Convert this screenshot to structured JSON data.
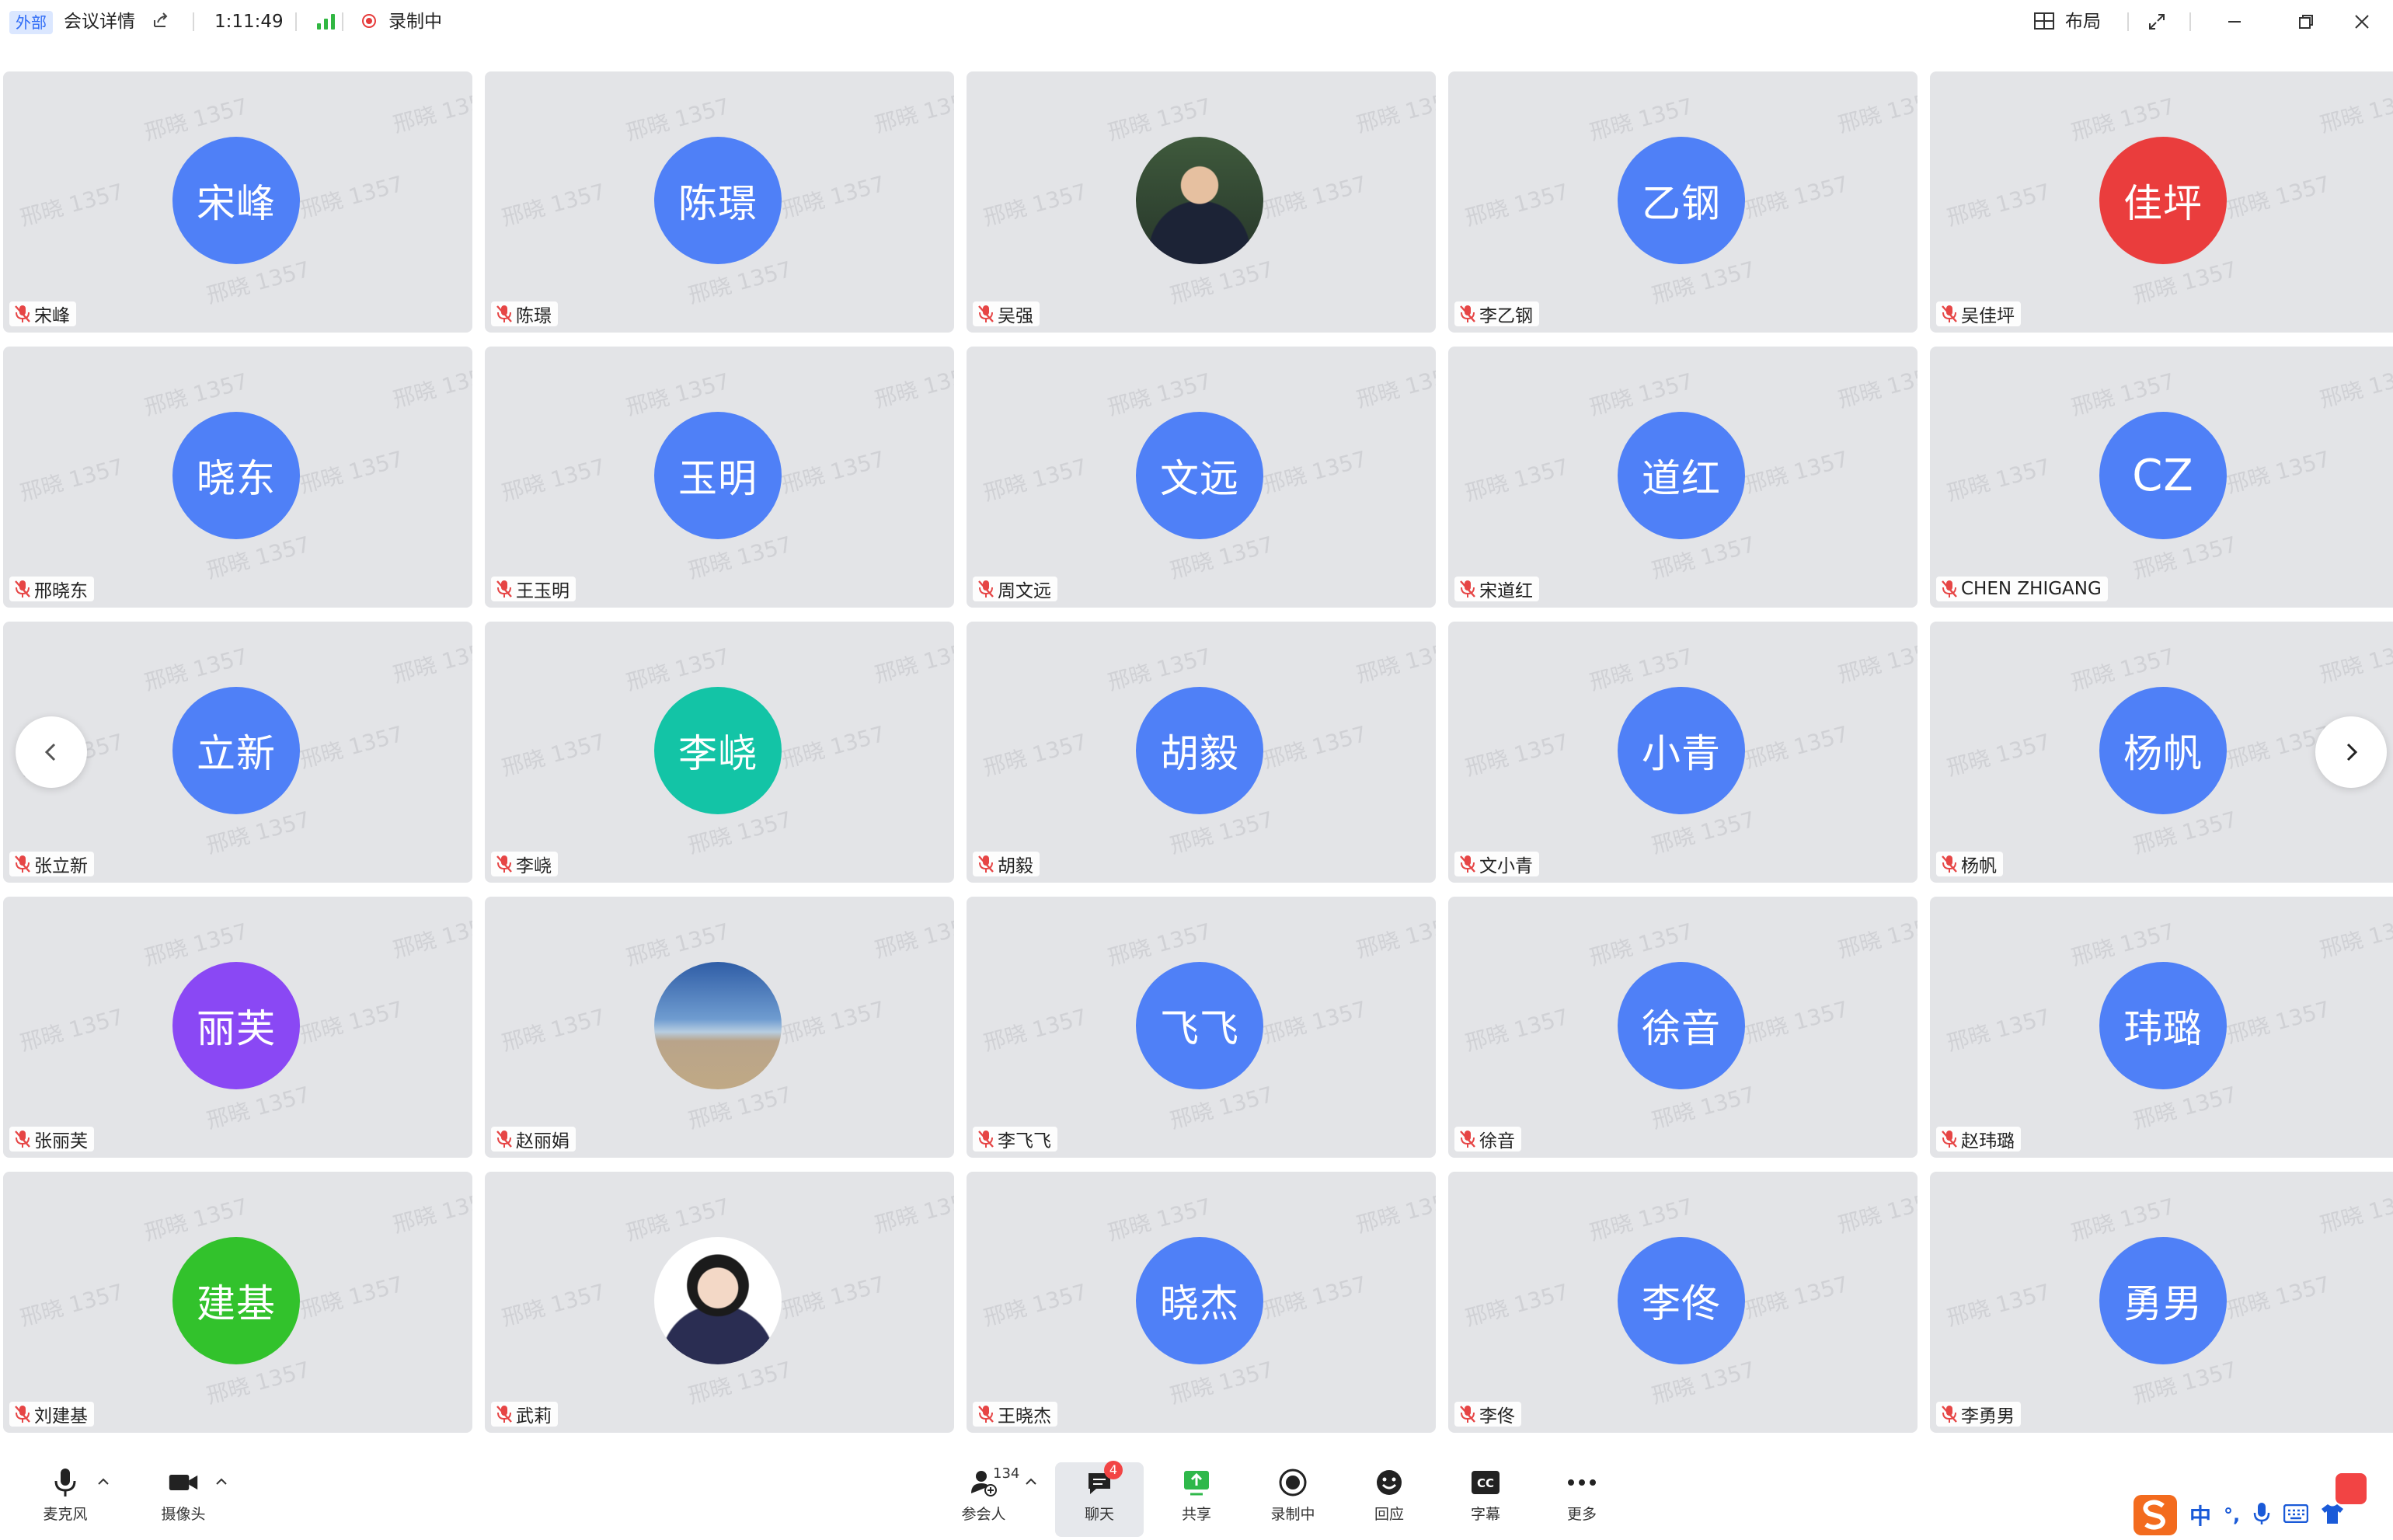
{
  "titlebar": {
    "external_tag": "外部",
    "meeting_details": "会议详情",
    "duration": "1:11:49",
    "recording": "录制中",
    "layout_label": "布局"
  },
  "watermark": "邢晓 1357",
  "participants": [
    {
      "avatar_text": "宋峰",
      "name": "宋峰",
      "avatar_style": "blue"
    },
    {
      "avatar_text": "陈璟",
      "name": "陈璟",
      "avatar_style": "blue"
    },
    {
      "avatar_text": "",
      "name": "吴强",
      "avatar_style": "photo-man"
    },
    {
      "avatar_text": "乙钢",
      "name": "李乙钢",
      "avatar_style": "blue"
    },
    {
      "avatar_text": "佳坪",
      "name": "吴佳坪",
      "avatar_style": "red"
    },
    {
      "avatar_text": "晓东",
      "name": "邢晓东",
      "avatar_style": "blue"
    },
    {
      "avatar_text": "玉明",
      "name": "王玉明",
      "avatar_style": "blue"
    },
    {
      "avatar_text": "文远",
      "name": "周文远",
      "avatar_style": "blue"
    },
    {
      "avatar_text": "道红",
      "name": "宋道红",
      "avatar_style": "blue"
    },
    {
      "avatar_text": "CZ",
      "name": "CHEN ZHIGANG",
      "avatar_style": "blue"
    },
    {
      "avatar_text": "立新",
      "name": "张立新",
      "avatar_style": "blue"
    },
    {
      "avatar_text": "李峣",
      "name": "李峣",
      "avatar_style": "teal"
    },
    {
      "avatar_text": "胡毅",
      "name": "胡毅",
      "avatar_style": "blue"
    },
    {
      "avatar_text": "小青",
      "name": "文小青",
      "avatar_style": "blue"
    },
    {
      "avatar_text": "杨帆",
      "name": "杨帆",
      "avatar_style": "blue"
    },
    {
      "avatar_text": "丽芙",
      "name": "张丽芙",
      "avatar_style": "purple"
    },
    {
      "avatar_text": "",
      "name": "赵丽娟",
      "avatar_style": "photo-sky"
    },
    {
      "avatar_text": "飞飞",
      "name": "李飞飞",
      "avatar_style": "blue"
    },
    {
      "avatar_text": "徐音",
      "name": "徐音",
      "avatar_style": "blue"
    },
    {
      "avatar_text": "玮璐",
      "name": "赵玮璐",
      "avatar_style": "blue"
    },
    {
      "avatar_text": "建基",
      "name": "刘建基",
      "avatar_style": "green"
    },
    {
      "avatar_text": "",
      "name": "武莉",
      "avatar_style": "photo-woman"
    },
    {
      "avatar_text": "晓杰",
      "name": "王晓杰",
      "avatar_style": "blue"
    },
    {
      "avatar_text": "李佟",
      "name": "李佟",
      "avatar_style": "blue"
    },
    {
      "avatar_text": "勇男",
      "name": "李勇男",
      "avatar_style": "blue"
    }
  ],
  "toolbar": {
    "mic": "麦克风",
    "camera": "摄像头",
    "participants": "参会人",
    "participant_count": "134",
    "chat": "聊天",
    "chat_badge": "4",
    "share": "共享",
    "recording": "录制中",
    "reactions": "回应",
    "captions": "字幕",
    "more": "更多"
  },
  "ime": {
    "lang": "中",
    "punct": "°,"
  },
  "colors": {
    "blue": "#4f80f7",
    "red": "#ea3d3d",
    "teal": "#13c4a6",
    "purple": "#8a48f4",
    "green": "#32c22c",
    "muted_red": "#e64545",
    "tile_bg": "#e3e4e7"
  }
}
